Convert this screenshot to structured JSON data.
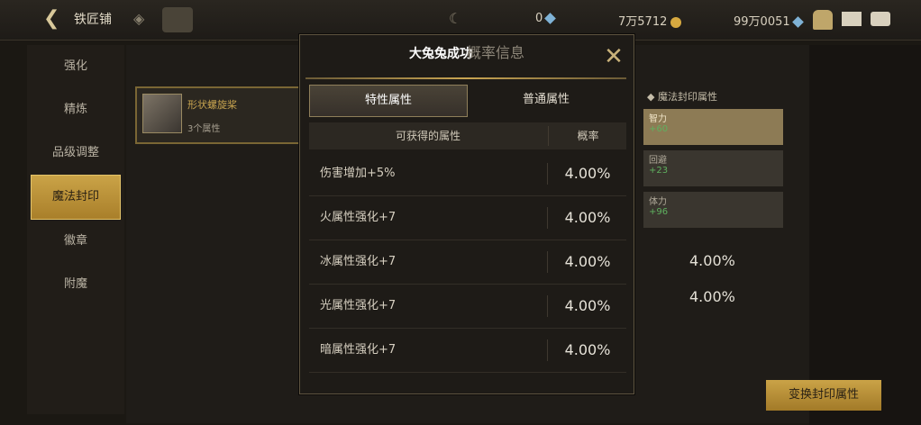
{
  "header": {
    "title": "铁匠铺",
    "resource_a": "0",
    "resource_b": "7万5712",
    "resource_c": "99万0051"
  },
  "sidebar": {
    "items": [
      {
        "label": "强化"
      },
      {
        "label": "精炼"
      },
      {
        "label": "品级调整"
      },
      {
        "label": "魔法封印"
      },
      {
        "label": "徽章"
      },
      {
        "label": "附魔"
      }
    ],
    "active_index": 3
  },
  "item_card": {
    "name": "形状螺旋桨",
    "sub": "3个属性"
  },
  "right_panel": {
    "heading": "◆ 魔法封印属性",
    "cards": [
      {
        "label": "智力",
        "value": "+60"
      },
      {
        "label": "回避",
        "value": "+23"
      },
      {
        "label": "体力",
        "value": "+96"
      }
    ],
    "pct1": "4.00%",
    "pct2": "4.00%",
    "button": "变换封印属性"
  },
  "modal": {
    "title": "大兔兔成功",
    "title_ghost": "概率信息",
    "close_icon": "close-icon",
    "tabs": [
      {
        "label": "特性属性",
        "active": true
      },
      {
        "label": "普通属性",
        "active": false
      }
    ],
    "col_attr": "可获得的属性",
    "col_prob": "概率",
    "rows": [
      {
        "attr": "伤害增加+5%",
        "prob": "4.00%"
      },
      {
        "attr": "火属性强化+7",
        "prob": "4.00%"
      },
      {
        "attr": "冰属性强化+7",
        "prob": "4.00%"
      },
      {
        "attr": "光属性强化+7",
        "prob": "4.00%"
      },
      {
        "attr": "暗属性强化+7",
        "prob": "4.00%"
      }
    ]
  },
  "colors": {
    "accent": "#c9a552",
    "bg": "#1b1813"
  }
}
